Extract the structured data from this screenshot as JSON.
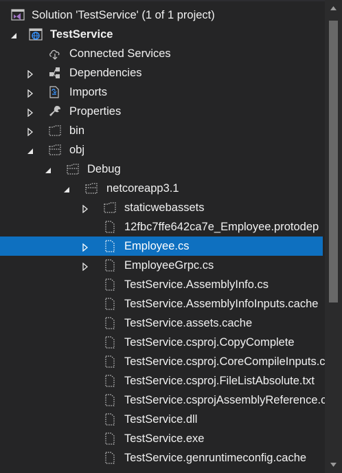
{
  "solution_explorer": {
    "solution_label": "Solution 'TestService' (1 of 1 project)",
    "project_label": "TestService",
    "items": {
      "connected_services": "Connected Services",
      "dependencies": "Dependencies",
      "imports": "Imports",
      "properties": "Properties",
      "bin": "bin",
      "obj": "obj",
      "debug": "Debug",
      "netcoreapp": "netcoreapp3.1",
      "staticwebassets": "staticwebassets",
      "protodep": "12fbc7ffe642ca7e_Employee.protodep",
      "employee_cs": "Employee.cs",
      "employee_grpc": "EmployeeGrpc.cs",
      "assembly_info": "TestService.AssemblyInfo.cs",
      "assembly_info_inputs": "TestService.AssemblyInfoInputs.cache",
      "assets_cache": "TestService.assets.cache",
      "copy_complete": "TestService.csproj.CopyComplete",
      "core_compile": "TestService.csproj.CoreCompileInputs.cache",
      "file_list": "TestService.csproj.FileListAbsolute.txt",
      "assembly_refs": "TestService.csprojAssemblyReference.cache",
      "dll": "TestService.dll",
      "exe": "TestService.exe",
      "genruntime": "TestService.genruntimeconfig.cache"
    },
    "selected_item": "Employee.cs"
  },
  "colors": {
    "background": "#252526",
    "selection": "#0e70c0",
    "text": "#f1f1f1",
    "icon_gray": "#c5c5c5",
    "solution_purple": "#a074c4",
    "project_blue": "#3794ff"
  }
}
